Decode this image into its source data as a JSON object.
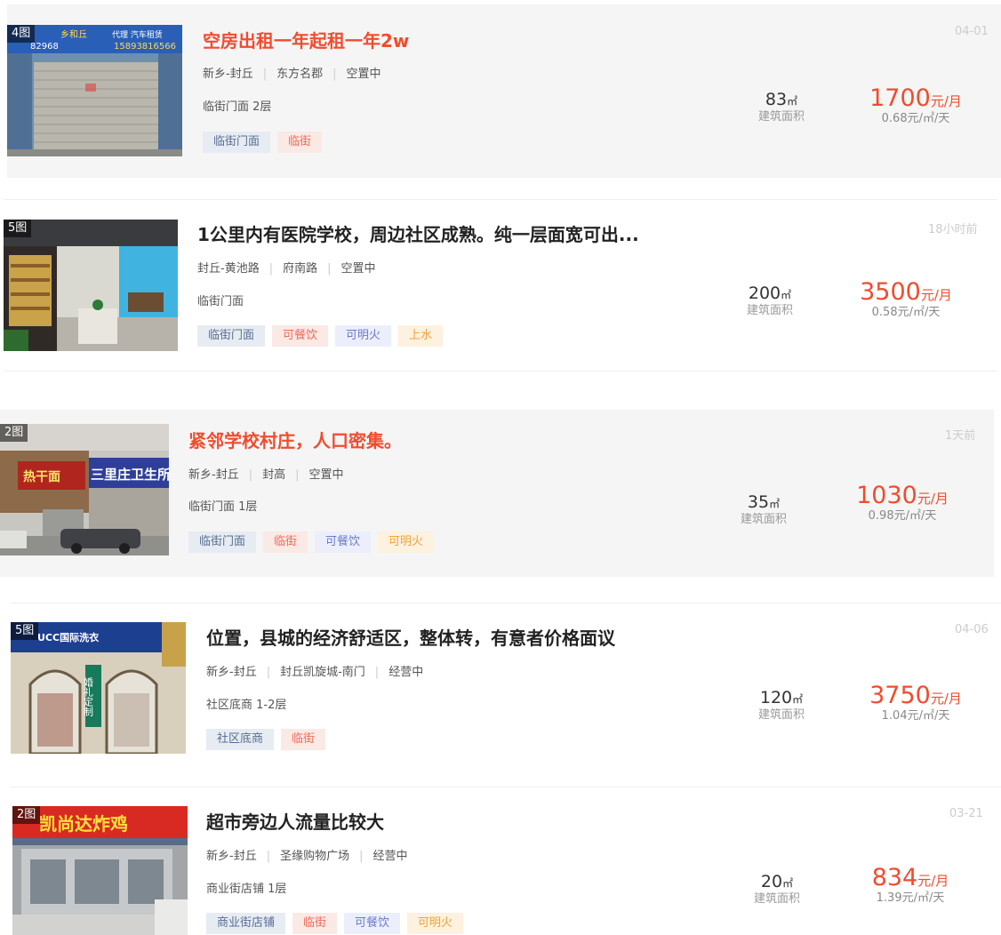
{
  "listings": [
    {
      "pic_count": "4图",
      "title": "空房出租一年起租一年2w",
      "region": "新乡-封丘",
      "location": "东方名郡",
      "status": "空置中",
      "type_floor": "临街门面 2层",
      "tags": [
        "临街门面",
        "临街"
      ],
      "area_value": "83",
      "area_unit": "㎡",
      "area_label": "建筑面积",
      "price_value": "1700",
      "price_unit": "元/月",
      "unit_price": "0.68元/㎡/天",
      "date": "04-01"
    },
    {
      "pic_count": "5图",
      "title": "1公里内有医院学校，周边社区成熟。纯一层面宽可出...",
      "region": "封丘-黄池路",
      "location": "府南路",
      "status": "空置中",
      "type_floor": "临街门面",
      "tags": [
        "临街门面",
        "可餐饮",
        "可明火",
        "上水"
      ],
      "area_value": "200",
      "area_unit": "㎡",
      "area_label": "建筑面积",
      "price_value": "3500",
      "price_unit": "元/月",
      "unit_price": "0.58元/㎡/天",
      "date": "18小时前"
    },
    {
      "pic_count": "2图",
      "title": "紧邻学校村庄，人口密集。",
      "region": "新乡-封丘",
      "location": "封高",
      "status": "空置中",
      "type_floor": "临街门面 1层",
      "tags": [
        "临街门面",
        "临街",
        "可餐饮",
        "可明火"
      ],
      "area_value": "35",
      "area_unit": "㎡",
      "area_label": "建筑面积",
      "price_value": "1030",
      "price_unit": "元/月",
      "unit_price": "0.98元/㎡/天",
      "date": "1天前"
    },
    {
      "pic_count": "5图",
      "title": "位置，县城的经济舒适区，整体转，有意者价格面议",
      "region": "新乡-封丘",
      "location": "封丘凯旋城-南门",
      "status": "经营中",
      "type_floor": "社区底商 1-2层",
      "tags": [
        "社区底商",
        "临街"
      ],
      "area_value": "120",
      "area_unit": "㎡",
      "area_label": "建筑面积",
      "price_value": "3750",
      "price_unit": "元/月",
      "unit_price": "1.04元/㎡/天",
      "date": "04-06"
    },
    {
      "pic_count": "2图",
      "title": "超市旁边人流量比较大",
      "region": "新乡-封丘",
      "location": "圣缘购物广场",
      "status": "经营中",
      "type_floor": "商业街店铺 1层",
      "tags": [
        "商业街店铺",
        "临街",
        "可餐饮",
        "可明火"
      ],
      "area_value": "20",
      "area_unit": "㎡",
      "area_label": "建筑面积",
      "price_value": "834",
      "price_unit": "元/月",
      "unit_price": "1.39元/㎡/天",
      "date": "03-21"
    }
  ],
  "tag_colors": {
    "临街门面": "blue",
    "社区底商": "blue",
    "商业街店铺": "blue",
    "临街": "red",
    "可餐饮": "red-or-lilac",
    "可明火": "lilac-or-orange",
    "上水": "orange"
  },
  "colors": {
    "accent_red": "#f04c2e",
    "highlight_bg": "#f5f5f5"
  },
  "thumb_signs": {
    "l0": [
      "乡和丘",
      "代理 汽车租赁",
      "82968",
      "15893816566"
    ],
    "l2": [
      "热干面",
      "三里庄卫生所"
    ],
    "l3": [
      "UCC国际洗衣",
      "婚礼定制"
    ],
    "l4": [
      "凯尚达炸鸡"
    ]
  }
}
